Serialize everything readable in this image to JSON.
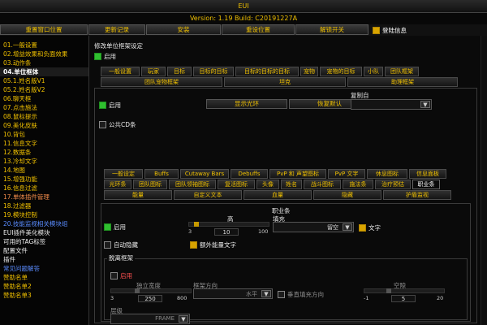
{
  "window": {
    "title": "EUI",
    "version": "Version: 1.19 Build: C20191227A"
  },
  "topbar": {
    "buttons": [
      "重置窗口位置",
      "更新记录",
      "安装",
      "重设位置",
      "解锁开关"
    ],
    "checkbox_label": "登陆信息"
  },
  "sidebar": {
    "items": [
      "01.一般设置",
      "02.增益效果和负面效果",
      "03.动作条",
      "04.单位框体",
      "05.1.姓名版V1",
      "05.2.姓名版V2",
      "06.聊天框",
      "07.点击施法",
      "08.鼠标提示",
      "09.美化皮肤",
      "10.背包",
      "11.信息文字",
      "12.数据条",
      "13.冷却文字",
      "14.地图",
      "15.增强功能",
      "16.信息过滤",
      "17.单体插件管理",
      "18.过滤器",
      "19.模块控制",
      "20.技能监视相关模块组",
      "EUI插件美化模块",
      "可用的TAG标签",
      "配置文件",
      "插件",
      "常见问题解答",
      "赞助名单",
      "赞助名单2",
      "赞助名单3"
    ]
  },
  "main": {
    "pane_title": "修改单位框架设定",
    "enable_label": "启用",
    "tabs_row1": [
      "一般设置",
      "玩家",
      "目标",
      "目标的目标",
      "目标的目标的目标",
      "宠物",
      "宠物的目标",
      "小队",
      "团队框架"
    ],
    "tabs_row2": [
      "团队宠物框架",
      "坦克",
      "助理框架"
    ],
    "inner": {
      "enable_label": "启用",
      "show_aura_btn": "显示光环",
      "restore_btn": "恢复默认",
      "copy_from_label": "复制自",
      "public_cd_label": "公共CD条"
    },
    "tabs_row3": [
      "一般设定",
      "Buffs",
      "Cutaway Bars",
      "Debuffs",
      "PvP 和 声望图标",
      "PvP 文字",
      "休息图标",
      "信息面板"
    ],
    "tabs_row4": [
      "光环条",
      "团队图标",
      "团队领袖图标",
      "复活图标",
      "头像",
      "姓名",
      "战斗图标",
      "施法条",
      "治疗预估",
      "职业条"
    ],
    "tabs_row5": [
      "能量",
      "自定义文本",
      "血量",
      "隐藏",
      "护盾监视"
    ],
    "classbar": {
      "title": "职业条",
      "enable_label": "启用",
      "height_label": "高",
      "height_min": "3",
      "height_value": "10",
      "height_max": "100",
      "fill_label": "填充",
      "fill_value": "留空",
      "text_label": "文字",
      "autohide_label": "自动隐藏",
      "extra_text_label": "额外能量文字",
      "height_fraction": 0.07
    },
    "detached": {
      "title": "脱离框架",
      "enable_label": "启用",
      "width_label": "独立宽度",
      "width_min": "3",
      "width_value": "250",
      "width_max": "800",
      "direction_label": "框架方向",
      "direction_value": "水平",
      "vertical_fill_label": "垂直填充方向",
      "spacing_label": "空隙",
      "spacing_min": "-1",
      "spacing_value": "5",
      "spacing_max": "20",
      "strata_label": "层级",
      "strata_value": "FRAME",
      "width_fraction": 0.31,
      "spacing_fraction": 0.29
    }
  },
  "colors": {
    "accent": "#f0c000",
    "checked": "#d8a400",
    "green": "#2fbf2f",
    "red": "#ff5050",
    "blue": "#5a8cff"
  }
}
